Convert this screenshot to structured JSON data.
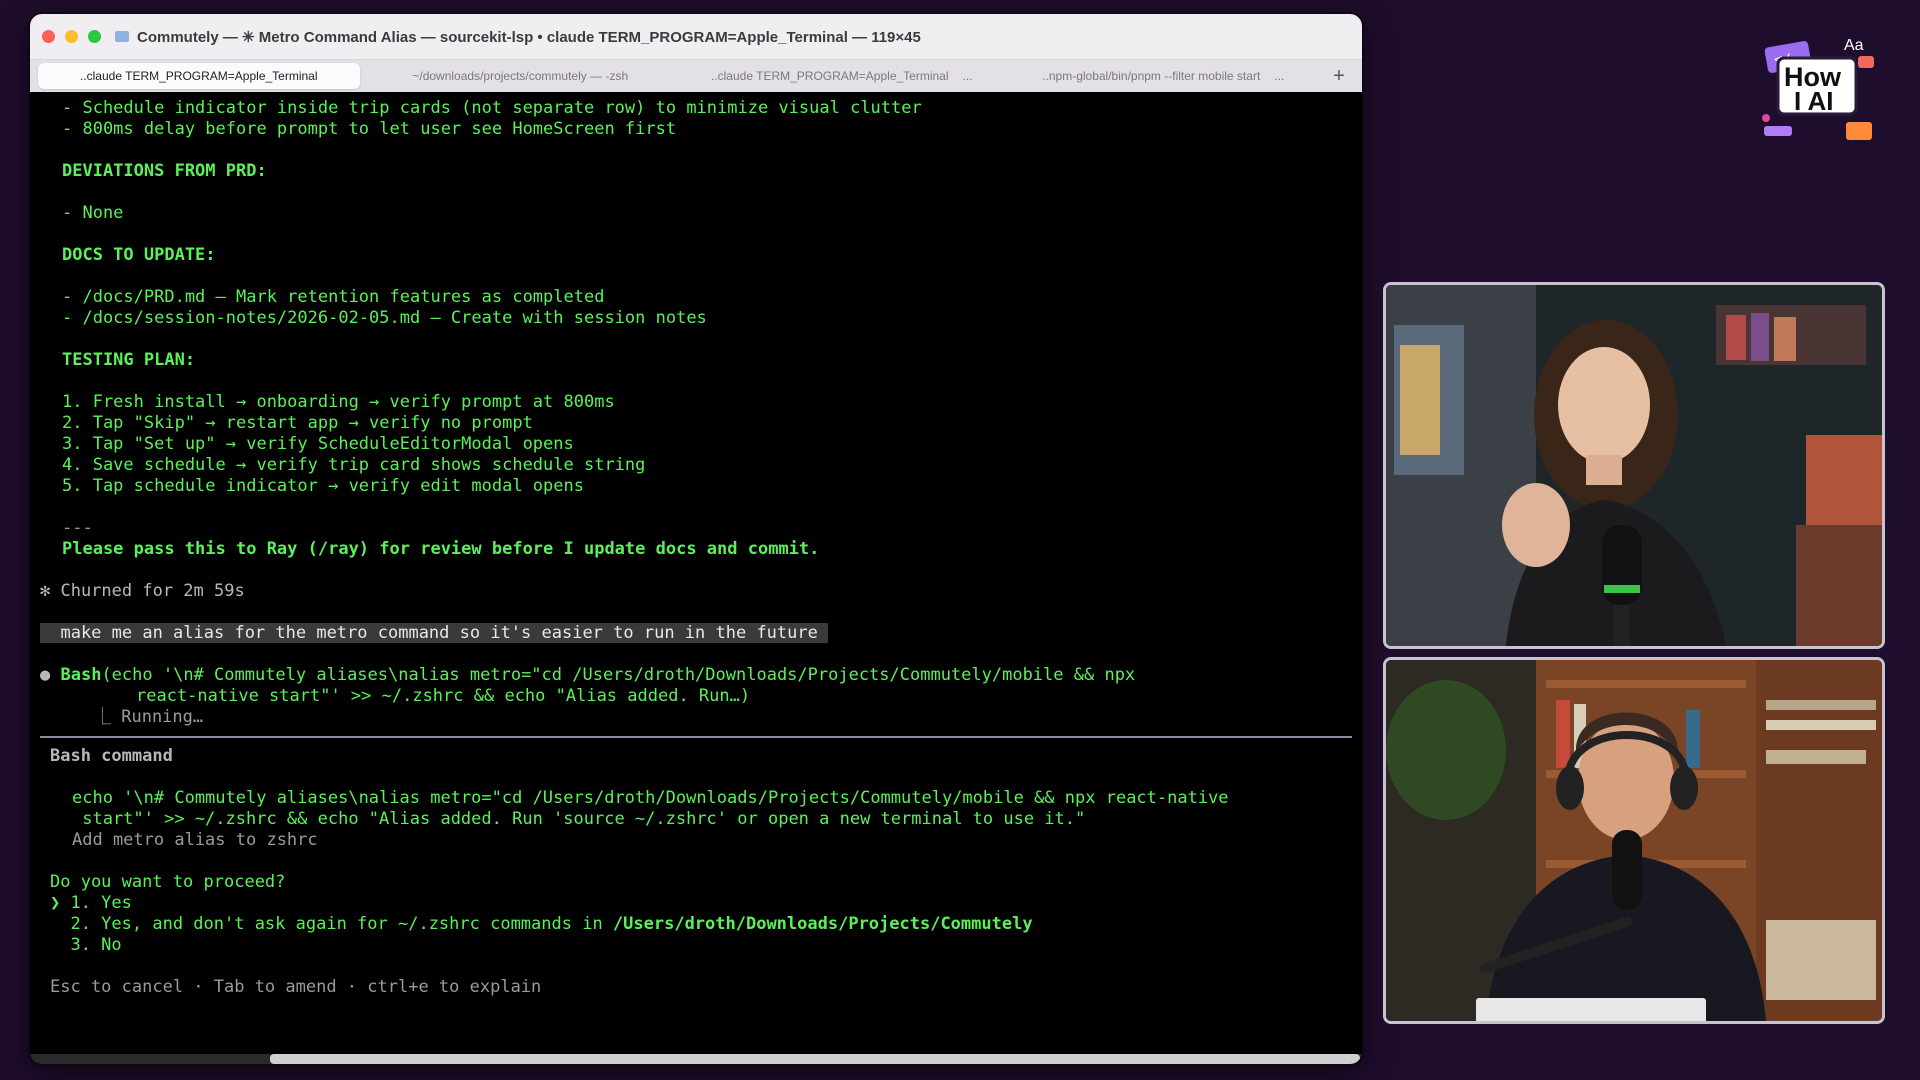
{
  "window": {
    "title": "Commutely — ✳ Metro Command Alias — sourcekit-lsp • claude TERM_PROGRAM=Apple_Terminal — 119×45",
    "tabs": [
      {
        "label": "..claude TERM_PROGRAM=Apple_Terminal",
        "active": true,
        "more": ""
      },
      {
        "label": "~/downloads/projects/commutely — -zsh",
        "active": false,
        "more": ""
      },
      {
        "label": "..claude TERM_PROGRAM=Apple_Terminal",
        "active": false,
        "more": "..."
      },
      {
        "label": "..npm-global/bin/pnpm --filter mobile start",
        "active": false,
        "more": "..."
      }
    ],
    "new_tab": "+"
  },
  "terminal": {
    "l1": "- Schedule indicator inside trip cards (not separate row) to minimize visual clutter",
    "l2": "- 800ms delay before prompt to let user see HomeScreen first",
    "deviations_header": "DEVIATIONS FROM PRD:",
    "deviations_item": "- None",
    "docs_header": "DOCS TO UPDATE:",
    "docs_1": "- /docs/PRD.md — Mark retention features as completed",
    "docs_2": "- /docs/session-notes/2026-02-05.md — Create with session notes",
    "testing_header": "TESTING PLAN:",
    "test_1": "1. Fresh install → onboarding → verify prompt at 800ms",
    "test_2": "2. Tap \"Skip\" → restart app → verify no prompt",
    "test_3": "3. Tap \"Set up\" → verify ScheduleEditorModal opens",
    "test_4": "4. Save schedule → verify trip card shows schedule string",
    "test_5": "5. Tap schedule indicator → verify edit modal opens",
    "separator": "---",
    "handoff": "Please pass this to Ray (/ray) for review before I update docs and commit.",
    "churned": "✻ Churned for 2m 59s",
    "user_prompt": "  make me an alias for the metro command so it's easier to run in the future ",
    "bash_label": "Bash",
    "bash_call_1": "(echo '\\n# Commutely aliases\\nalias metro=\"cd /Users/droth/Downloads/Projects/Commutely/mobile && npx",
    "bash_call_2": "react-native start\"' >> ~/.zshrc && echo \"Alias added. Run…)",
    "running": "⎿ Running…",
    "panel_title": "Bash command",
    "cmd_1": "echo '\\n# Commutely aliases\\nalias metro=\"cd /Users/droth/Downloads/Projects/Commutely/mobile && npx react-native",
    "cmd_2": " start\"' >> ~/.zshrc && echo \"Alias added. Run 'source ~/.zshrc' or open a new terminal to use it.\"",
    "cmd_desc": "Add metro alias to zshrc",
    "question": "Do you want to proceed?",
    "opt_1": "❯ 1. Yes",
    "opt_2_prefix": "  2. Yes, and don't ask again for ~/.zshrc commands in ",
    "opt_2_path": "/Users/droth/Downloads/Projects/Commutely",
    "opt_3": "  3. No",
    "footer_hint": "Esc to cancel · Tab to amend · ctrl+e to explain"
  },
  "logo": {
    "line1": "How",
    "line2": "I AI",
    "badge": "Aa"
  },
  "colors": {
    "background": "#1e0d2c",
    "terminal_green": "#5cf05a",
    "terminal_bg": "#000000"
  }
}
